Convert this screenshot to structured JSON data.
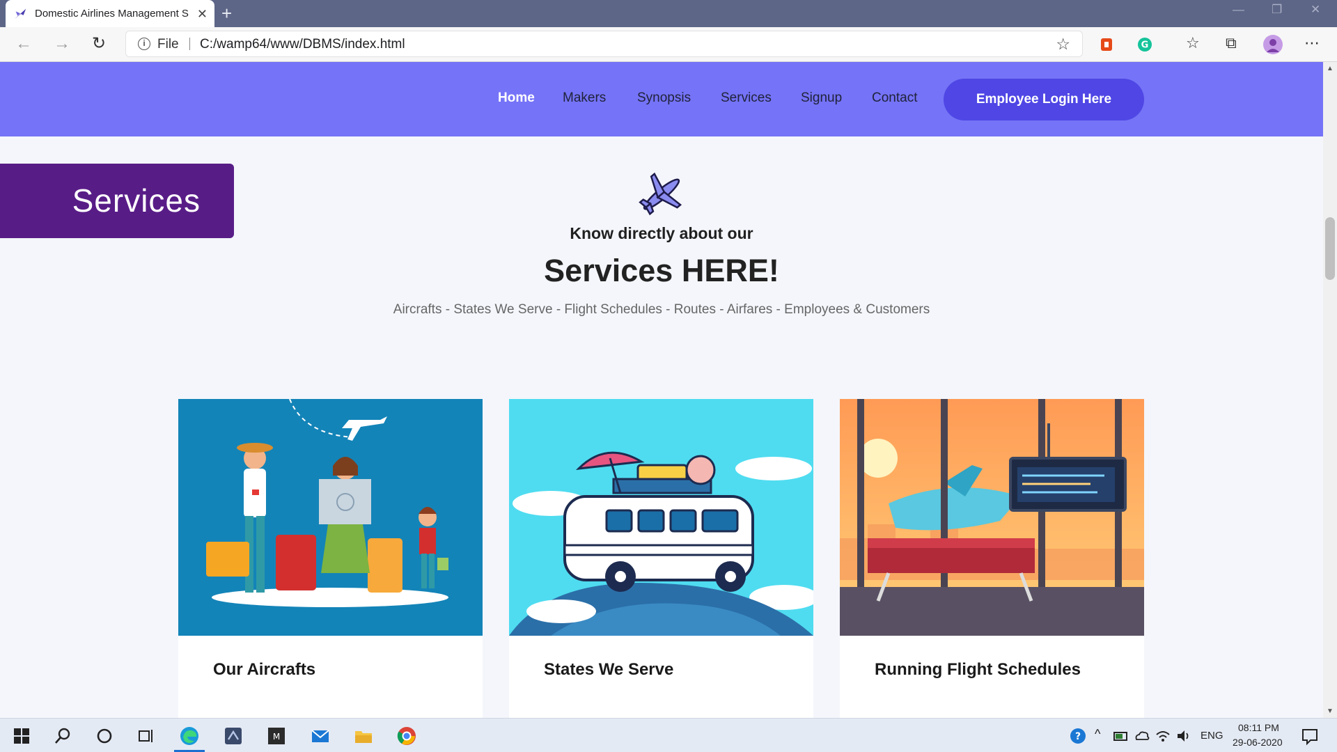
{
  "browser": {
    "tab_title": "Domestic Airlines Management S",
    "tab_close": "✕",
    "new_tab": "+",
    "file_label": "File",
    "url": "C:/wamp64/www/DBMS/index.html"
  },
  "nav": {
    "links": [
      "Home",
      "Makers",
      "Synopsis",
      "Services",
      "Signup",
      "Contact"
    ],
    "active": "Home",
    "login_button": "Employee Login Here"
  },
  "section": {
    "banner": "Services",
    "subhead": "Know directly about our",
    "title": "Services HERE!",
    "list": "Aircrafts - States We Serve - Flight Schedules - Routes - Airfares - Employees & Customers"
  },
  "cards": [
    {
      "title": "Our Aircrafts",
      "icon": "travel-family-illustration"
    },
    {
      "title": "States We Serve",
      "icon": "camper-van-illustration"
    },
    {
      "title": "Running Flight Schedules",
      "icon": "airport-lounge-illustration"
    }
  ],
  "taskbar": {
    "lang": "ENG",
    "time": "08:11 PM",
    "date": "29-06-2020"
  },
  "colors": {
    "nav_bg": "#7573f7",
    "login_bg": "#4f46e5",
    "banner_bg": "#581c87"
  }
}
